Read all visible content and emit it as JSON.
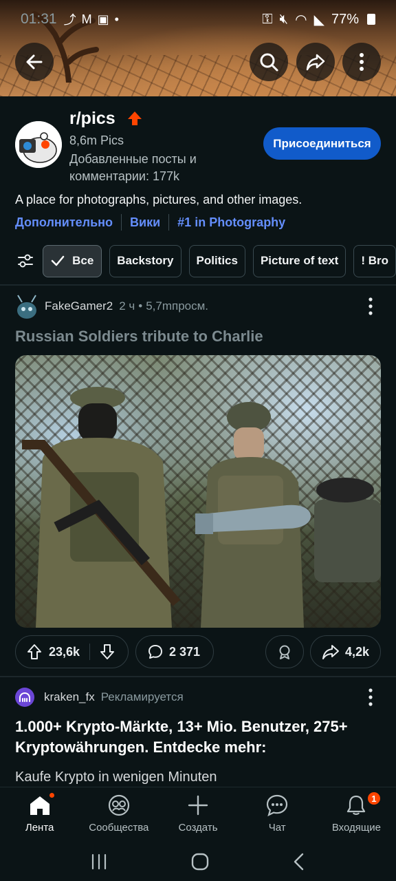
{
  "status_bar": {
    "time": "01:31",
    "battery": "77%"
  },
  "subreddit": {
    "name": "r/pics",
    "members": "8,6m Pics",
    "contributions": "Добавленные посты и комментарии: 177k",
    "join_label": "Присоединиться",
    "description": "A place for photographs, pictures, and other images.",
    "links": [
      {
        "label": "Дополнительно"
      },
      {
        "label": "Вики"
      },
      {
        "label": "#1 in Photography"
      }
    ]
  },
  "filters": {
    "chips": [
      {
        "label": "Все",
        "active": true
      },
      {
        "label": "Backstory",
        "active": false
      },
      {
        "label": "Politics",
        "active": false
      },
      {
        "label": "Picture of text",
        "active": false
      },
      {
        "label": "! Bro",
        "active": false
      }
    ]
  },
  "post": {
    "author": "FakeGamer2",
    "time": "2 ч",
    "views": "5,7mпросм.",
    "title": "Russian Soldiers tribute to Charlie",
    "score": "23,6k",
    "comments": "2 371",
    "shares": "4,2k"
  },
  "ad": {
    "author": "kraken_fx",
    "promoted": "Рекламируется",
    "title": "1.000+ Krypto-Märkte, 13+ Mio. Benutzer, 275+ Kryptowährungen. Entdecke mehr:",
    "body": "Kaufe Krypto in wenigen Minuten"
  },
  "bottom_nav": {
    "items": [
      {
        "label": "Лента",
        "icon": "home-icon",
        "active": true
      },
      {
        "label": "Сообщества",
        "icon": "communities-icon",
        "active": false
      },
      {
        "label": "Создать",
        "icon": "plus-icon",
        "active": false
      },
      {
        "label": "Чат",
        "icon": "chat-icon",
        "active": false
      },
      {
        "label": "Входящие",
        "icon": "bell-icon",
        "active": false
      }
    ],
    "inbox_badge": "1"
  },
  "colors": {
    "background": "#0b1416",
    "join_button": "#115bca",
    "link": "#648efc",
    "accent": "#ff4500"
  }
}
